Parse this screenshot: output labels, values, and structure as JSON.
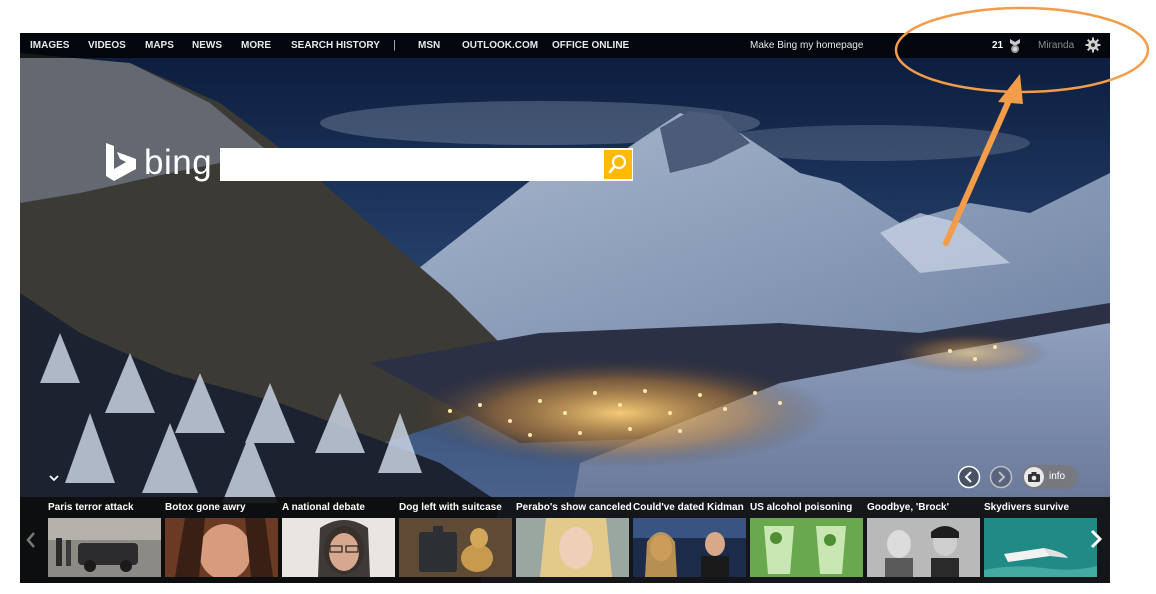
{
  "nav": {
    "items": [
      "IMAGES",
      "VIDEOS",
      "MAPS",
      "NEWS",
      "MORE",
      "SEARCH HISTORY"
    ],
    "separator": "|",
    "links": [
      "MSN",
      "OUTLOOK.COM",
      "OFFICE ONLINE"
    ],
    "homepage_link": "Make Bing my homepage",
    "rewards_count": "21",
    "username": "Miranda"
  },
  "logo": {
    "text": "bing"
  },
  "search": {
    "value": "",
    "placeholder": ""
  },
  "controls": {
    "info_label": "info"
  },
  "news": {
    "tiles": [
      {
        "title": "Paris terror attack"
      },
      {
        "title": "Botox gone awry"
      },
      {
        "title": "A national debate"
      },
      {
        "title": "Dog left with suitcase"
      },
      {
        "title": "Perabo's show canceled"
      },
      {
        "title": "Could've dated Kidman"
      },
      {
        "title": "US alcohol poisoning"
      },
      {
        "title": "Goodbye, 'Brock'"
      },
      {
        "title": "Skydivers survive"
      }
    ]
  },
  "colors": {
    "search_accent": "#ffb900",
    "annotation": "#f39c4a",
    "top_bar": "#1a1a1a"
  }
}
